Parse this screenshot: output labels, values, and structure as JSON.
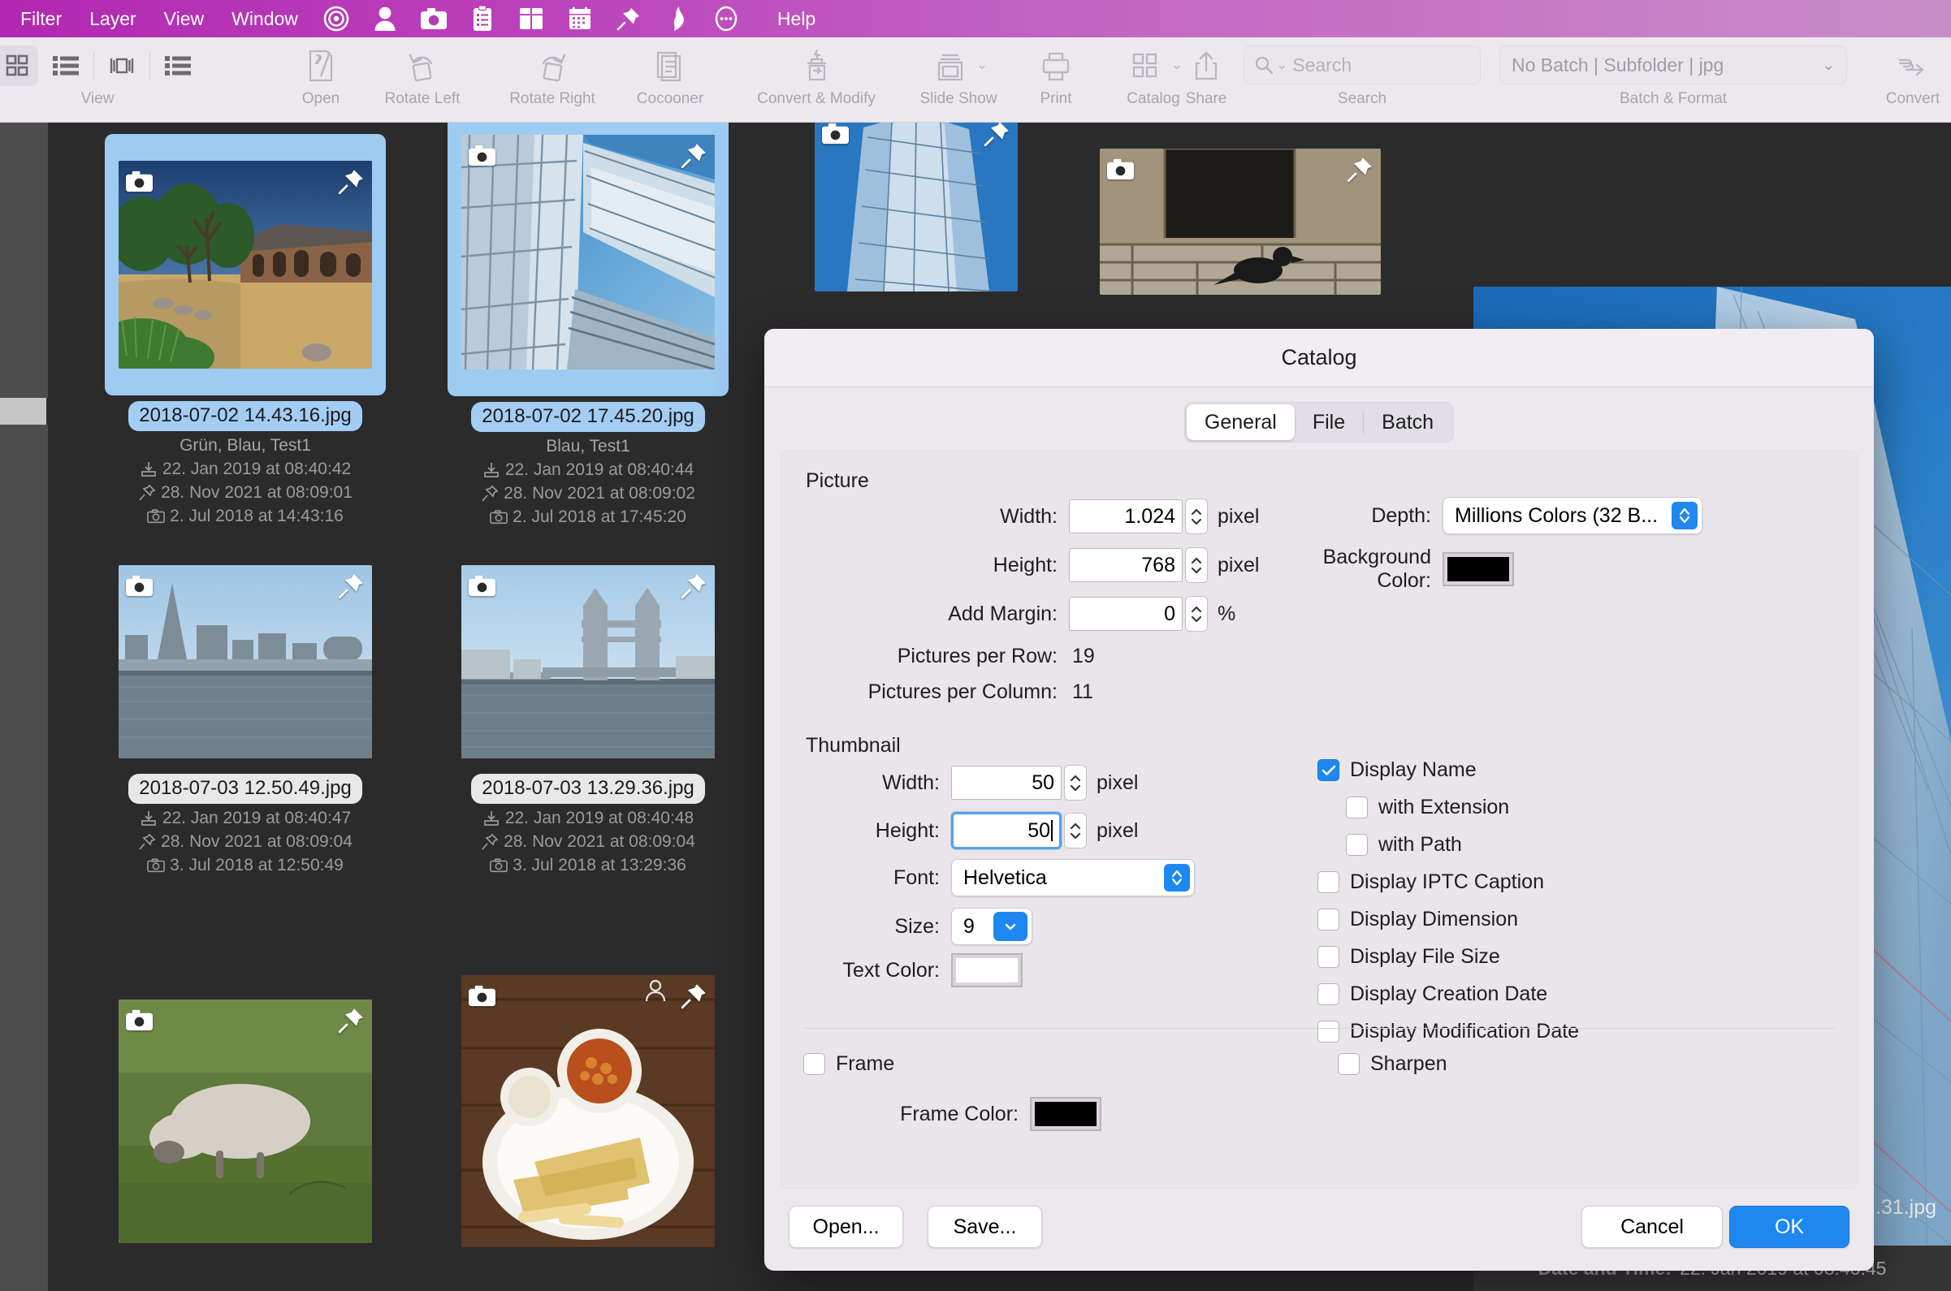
{
  "menubar": {
    "items": [
      "Filter",
      "Layer",
      "View",
      "Window"
    ],
    "help": "Help",
    "icons": [
      "target-icon",
      "person-icon",
      "camera-icon",
      "clipboard-icon",
      "book-icon",
      "calendar-icon",
      "pin-icon",
      "flame-icon",
      "ellipsis-circle-icon"
    ]
  },
  "toolbar": {
    "groups": [
      {
        "label": "View"
      },
      {
        "label": "Open"
      },
      {
        "label": "Rotate Left"
      },
      {
        "label": "Rotate Right"
      },
      {
        "label": "Cocooner"
      },
      {
        "label": "Convert & Modify"
      },
      {
        "label": "Slide Show"
      },
      {
        "label": "Print"
      },
      {
        "label": "Catalog"
      },
      {
        "label": "Share"
      },
      {
        "label": "Search"
      },
      {
        "label": "Batch & Format"
      },
      {
        "label": "Convert"
      }
    ],
    "search_placeholder": "Search",
    "batch_value": "No Batch | Subfolder | jpg"
  },
  "grid": {
    "items": [
      {
        "filename": "2018-07-02 14.43.16.jpg",
        "selected": true,
        "tags": "Grün, Blau, Test1",
        "import_date": "22. Jan 2019 at 08:40:42",
        "modify_date": "28. Nov 2021 at 08:09:01",
        "capture_date": "2. Jul 2018 at 14:43:16"
      },
      {
        "filename": "2018-07-02 17.45.20.jpg",
        "selected": true,
        "tags": "Blau, Test1",
        "import_date": "22. Jan 2019 at 08:40:44",
        "modify_date": "28. Nov 2021 at 08:09:02",
        "capture_date": "2. Jul 2018 at 17:45:20"
      },
      {
        "filename": "2018-07-03 12.50.49.jpg",
        "selected": false,
        "tags": "",
        "import_date": "22. Jan 2019 at 08:40:47",
        "modify_date": "28. Nov 2021 at 08:09:04",
        "capture_date": "3. Jul 2018 at 12:50:49"
      },
      {
        "filename": "2018-07-03 13.29.36.jpg",
        "selected": false,
        "tags": "",
        "import_date": "22. Jan 2019 at 08:40:48",
        "modify_date": "28. Nov 2021 at 08:09:04",
        "capture_date": "3. Jul 2018 at 13:29:36"
      }
    ]
  },
  "preview_info": {
    "filename_tail": ".31.jpg",
    "date_label": "Date and Time:",
    "date_value": "22. Jan 2019 at 08:40:45"
  },
  "dialog": {
    "title": "Catalog",
    "tabs": [
      {
        "label": "General",
        "active": true
      },
      {
        "label": "File",
        "active": false
      },
      {
        "label": "Batch",
        "active": false
      }
    ],
    "picture": {
      "section_label": "Picture",
      "width_label": "Width:",
      "width_value": "1.024",
      "width_unit": "pixel",
      "height_label": "Height:",
      "height_value": "768",
      "height_unit": "pixel",
      "margin_label": "Add Margin:",
      "margin_value": "0",
      "margin_unit": "%",
      "per_row_label": "Pictures per Row:",
      "per_row_value": "19",
      "per_col_label": "Pictures per Column:",
      "per_col_value": "11",
      "depth_label": "Depth:",
      "depth_value": "Millions Colors (32 B...",
      "bgcolor_label": "Background Color:",
      "bgcolor_value": "#000000"
    },
    "thumbnail": {
      "section_label": "Thumbnail",
      "width_label": "Width:",
      "width_value": "50",
      "width_unit": "pixel",
      "height_label": "Height:",
      "height_value": "50",
      "height_unit": "pixel",
      "font_label": "Font:",
      "font_value": "Helvetica",
      "size_label": "Size:",
      "size_value": "9",
      "textcolor_label": "Text Color:",
      "textcolor_value": "#ffffff"
    },
    "display_options": [
      {
        "label": "Display Name",
        "checked": true,
        "indent": false
      },
      {
        "label": "with Extension",
        "checked": false,
        "indent": true
      },
      {
        "label": "with Path",
        "checked": false,
        "indent": true
      },
      {
        "label": "Display IPTC Caption",
        "checked": false,
        "indent": false
      },
      {
        "label": "Display Dimension",
        "checked": false,
        "indent": false
      },
      {
        "label": "Display File Size",
        "checked": false,
        "indent": false
      },
      {
        "label": "Display Creation Date",
        "checked": false,
        "indent": false
      },
      {
        "label": "Display Modification Date",
        "checked": false,
        "indent": false
      }
    ],
    "frame": {
      "frame_label": "Frame",
      "frame_checked": false,
      "sharpen_label": "Sharpen",
      "sharpen_checked": false,
      "frame_color_label": "Frame Color:",
      "frame_color_value": "#000000"
    },
    "buttons": {
      "open": "Open...",
      "save": "Save...",
      "cancel": "Cancel",
      "ok": "OK"
    }
  },
  "colors": {
    "menubar_start": "#b128b1",
    "menubar_end": "#c98ec9",
    "accent_blue": "#1e88f0",
    "selection_blue": "#a3cdf3",
    "desktop": "#2b2b2b"
  }
}
